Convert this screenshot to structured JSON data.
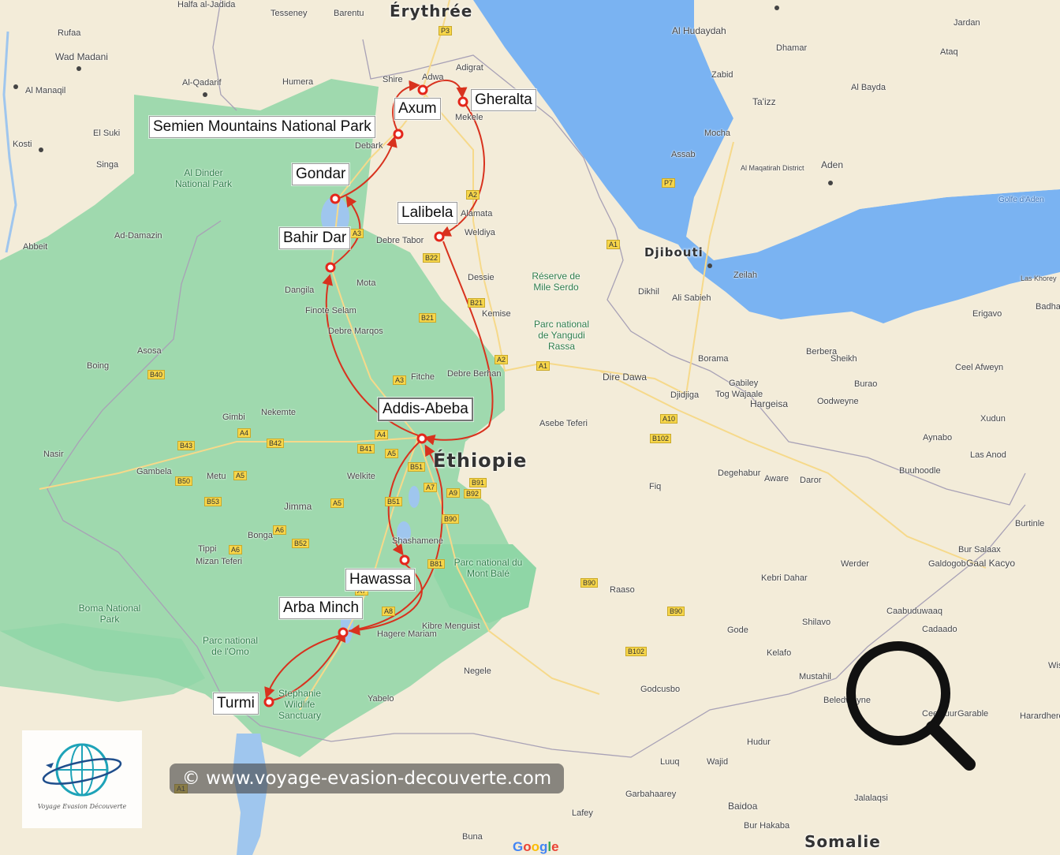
{
  "stops": [
    {
      "id": "semien",
      "label": "Semien Mountains National Park"
    },
    {
      "id": "axum",
      "label": "Axum"
    },
    {
      "id": "gheralta",
      "label": "Gheralta"
    },
    {
      "id": "gondar",
      "label": "Gondar"
    },
    {
      "id": "lalibela",
      "label": "Lalibela"
    },
    {
      "id": "bahirdar",
      "label": "Bahir Dar"
    },
    {
      "id": "addis",
      "label": "Addis-Abeba"
    },
    {
      "id": "hawassa",
      "label": "Hawassa"
    },
    {
      "id": "arbaminch",
      "label": "Arba Minch"
    },
    {
      "id": "turmi",
      "label": "Turmi"
    }
  ],
  "countries": {
    "eritrea": "Érythrée",
    "ethiopia": "Éthiopie",
    "djibouti": "Djibouti",
    "somalia": "Somalie"
  },
  "places": {
    "khartoum_area": "Halfa al-Jadida",
    "rufaa": "Rufaa",
    "wad_madani": "Wad Madani",
    "al_manaqil": "Al Manaqil",
    "kosti": "Kosti",
    "singa": "Singa",
    "al_qadarif": "Al-Qadarif",
    "el_suki": "El Suki",
    "gedaref_park": "Al Dinder National Park",
    "tesseney": "Tesseney",
    "barentu": "Barentu",
    "humera": "Humera",
    "shire": "Shire",
    "adwa": "Adwa",
    "adigrat": "Adigrat",
    "mekele": "Mekele",
    "debark": "Debark",
    "debre_tabor": "Debre Tabor",
    "weldiya": "Weldiya",
    "alamata": "Alamata",
    "dessie": "Dessie",
    "kemise": "Kemise",
    "debre_berhan": "Debre Berhan",
    "mota": "Mota",
    "dangila": "Dangila",
    "finote_selam": "Finote Selam",
    "debre_marqos": "Debre Marqos",
    "fitche": "Fitche",
    "nekemte": "Nekemte",
    "gimbi": "Gimbi",
    "asosa": "Asosa",
    "boing": "Boing",
    "nasir": "Nasir",
    "gambela": "Gambela",
    "metu": "Metu",
    "jimma": "Jimma",
    "bonga": "Bonga",
    "tippi": "Tippi",
    "mizan": "Mizan Teferi",
    "welkite": "Welkite",
    "shashamene": "Shashamene",
    "hagere_mariam": "Hagere Mariam",
    "yabelo": "Yabelo",
    "negele": "Negele",
    "kibre_mengist": "Kibre Menguist",
    "dire_dawa": "Dire Dawa",
    "djidjiga": "Djidjiga",
    "hargeisa": "Hargeisa",
    "asebe_teferi": "Asebe Teferi",
    "degehabur": "Degehabur",
    "kebri_dahar": "Kebri Dahar",
    "gode": "Gode",
    "werder": "Werder",
    "galkayo": "Gaal Kacyo",
    "burao": "Burao",
    "erigavo": "Erigavo",
    "berbera": "Berbera",
    "beledweyne": "Beledweyne",
    "baidoa": "Baidoa",
    "luuq": "Luuq",
    "garbahaarey": "Garbahaarey",
    "lafey": "Lafey",
    "buna": "Buna",
    "sanaa_area": "Al Hudaydah",
    "taizz": "Ta'izz",
    "aden": "Aden",
    "zabid": "Zabid",
    "mocha": "Mocha",
    "assab": "Assab",
    "dhamar": "Dhamar",
    "ataq": "Ataq",
    "jardan": "Jardan",
    "al_bayda": "Al Bayda",
    "sheikh": "Sheikh",
    "oodweyne": "Oodweyne",
    "ceel_afweyn": "Ceel Afweyn",
    "xudun": "Xudun",
    "buuhoodle": "Buuhoodle",
    "las_anod": "Las Anod",
    "bur_salaax": "Bur Salaax",
    "galdogob": "Galdogob",
    "burtinle": "Burtinle",
    "raaso": "Raaso",
    "shilavo": "Shilavo",
    "kelafo": "Kelafo",
    "mustahil": "Mustahil",
    "godcusbo": "Godcusbo",
    "hudur": "Hudur",
    "wajid": "Wajid",
    "jalalaqsi": "Jalalaqsi",
    "bur_hakaba": "Bur Hakaba",
    "cadaado": "Cadaado",
    "caabuduwaaq": "Caabuduwaaq",
    "dikhil": "Dikhil",
    "ali_sabieh": "Ali Sabieh",
    "obock": "Zeilah",
    "fiq": "Fiq",
    "aware": "Aware",
    "daror": "Daror",
    "gabiley": "Gabiley",
    "borama": "Borama",
    "tog_wajaale": "Tog Wajaale",
    "aynabo": "Aynabo",
    "golfe_aden": "Golfe d'Aden",
    "las_khorey": "Las Khorey",
    "badhan": "Badhan",
    "abbeit": "Abbeit",
    "ad_damazin": "Ad-Damazin",
    "raaso2": "Garable",
    "harardhere": "Harardhere",
    "wisil": "Wisil",
    "ceelbuur": "Ceelbuur",
    "al_maqatirah": "Al Maqatirah District"
  },
  "parks": {
    "mile_serdo": "Réserve de Mile Serdo",
    "yangudi": "Parc national de Yangudi Rassa",
    "bale": "Parc national du Mont Balé",
    "omo": "Parc national de l'Omo",
    "boma": "Boma National Park",
    "stephanie": "Stephanie Wildlife Sanctuary"
  },
  "roads": [
    "P3",
    "A2",
    "A1",
    "P7",
    "B22",
    "B21",
    "A3",
    "A2",
    "A1",
    "B21",
    "A3",
    "A4",
    "A5",
    "B41",
    "B51",
    "B43",
    "B42",
    "B40",
    "A4",
    "B50",
    "A5",
    "B53",
    "A5",
    "A6",
    "A6",
    "B52",
    "A7",
    "A9",
    "B91",
    "B92",
    "B90",
    "B51",
    "B81",
    "A7",
    "A8",
    "B90",
    "B102",
    "A10",
    "B102",
    "A1",
    "B90"
  ],
  "watermark": "© www.voyage-evasion-decouverte.com",
  "logo_text": "Voyage Evasion Découverte",
  "google_logo": "Google",
  "colors": {
    "route": "#d8321e",
    "water": "#9fc6ee",
    "sea": "#66a7f0",
    "green": "#8fd6a6",
    "land": "#f3ecd9"
  }
}
